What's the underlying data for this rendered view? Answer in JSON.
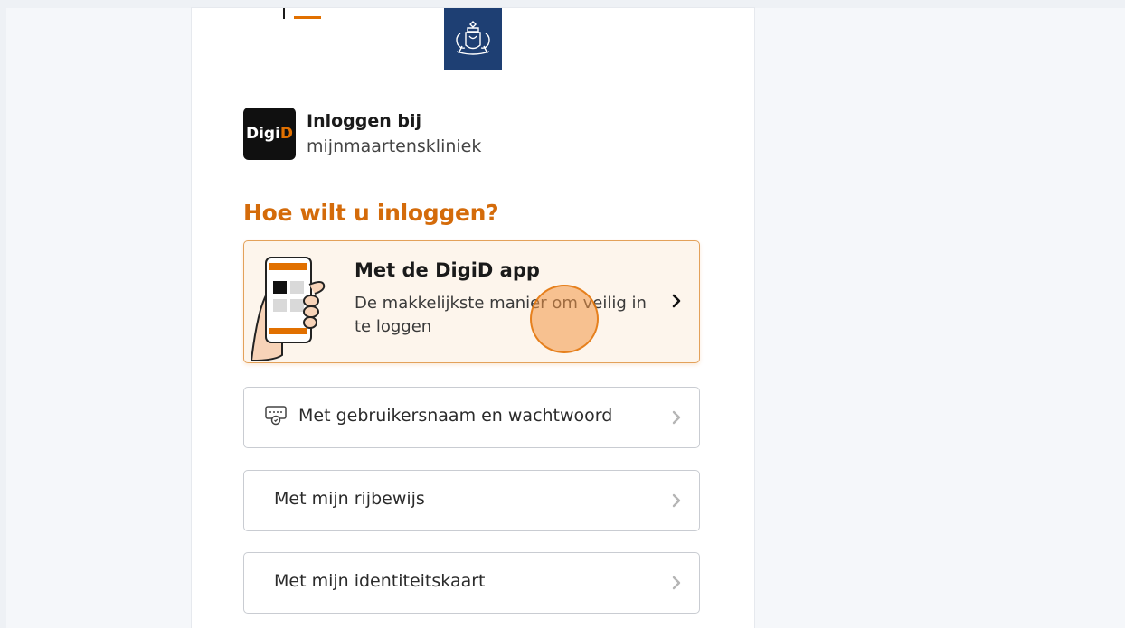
{
  "header": {
    "logo_name": "rijksoverheid-logo"
  },
  "login": {
    "digid_logo_white": "Digi",
    "digid_logo_orange": "D",
    "intro_line1": "Inloggen bij",
    "intro_line2": "mijnmaartenskliniek"
  },
  "heading": "Hoe wilt u inloggen?",
  "options": [
    {
      "title": "Met de DigiD app",
      "description": "De makkelijkste manier om veilig in te loggen",
      "icon": "phone-app-illustration"
    },
    {
      "label": "Met gebruikersnaam en wachtwoord",
      "icon": "password-keypad-icon"
    },
    {
      "label": "Met mijn rijbewijs"
    },
    {
      "label": "Met mijn identiteitskaart"
    }
  ],
  "colors": {
    "accent": "#e17000",
    "heading": "#d46b0a",
    "brand_blue": "#1e3f73"
  }
}
